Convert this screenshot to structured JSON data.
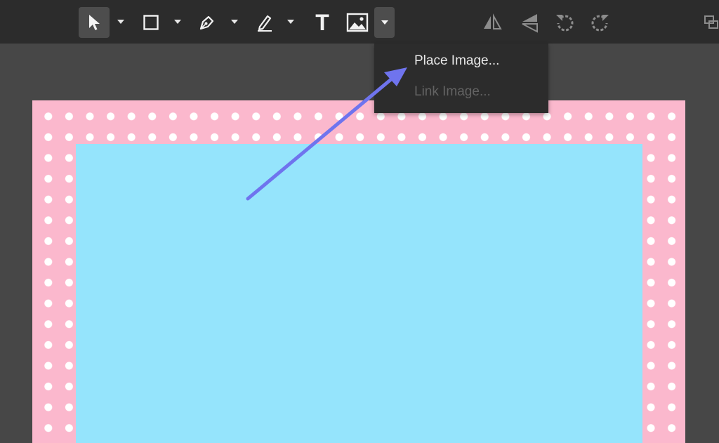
{
  "toolbar": {
    "tools": [
      {
        "name": "select-tool",
        "icon": "pointer-icon",
        "active": true
      },
      {
        "name": "rectangle-tool",
        "icon": "square-icon"
      },
      {
        "name": "pen-tool",
        "icon": "pen-nib-icon"
      },
      {
        "name": "pencil-tool",
        "icon": "pencil-icon"
      },
      {
        "name": "text-tool",
        "icon": "text-icon",
        "glyph": "T"
      },
      {
        "name": "image-tool",
        "icon": "image-icon"
      },
      {
        "name": "flip-horizontal",
        "icon": "flip-horizontal-icon"
      },
      {
        "name": "flip-vertical",
        "icon": "flip-vertical-icon"
      },
      {
        "name": "rotate-left",
        "icon": "rotate-ccw-icon"
      },
      {
        "name": "rotate-right",
        "icon": "rotate-cw-icon"
      }
    ]
  },
  "image_menu": {
    "items": [
      {
        "label": "Place Image...",
        "enabled": true
      },
      {
        "label": "Link Image...",
        "enabled": false
      }
    ]
  },
  "canvas": {
    "border_color": "#fbb8cd",
    "dot_color": "#ffffff",
    "fill_color": "#95e4fc"
  },
  "annotation": {
    "arrow_color": "#6f74ee",
    "icon": "arrow-annotation-icon"
  }
}
